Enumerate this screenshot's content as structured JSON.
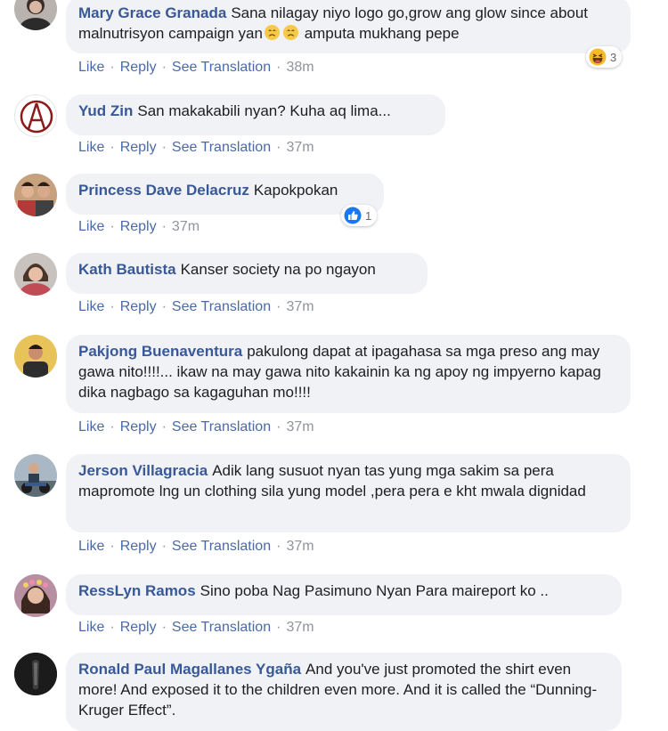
{
  "actions": {
    "like": "Like",
    "reply": "Reply",
    "see_translation": "See Translation"
  },
  "comments": [
    {
      "author": "Mary Grace Granada",
      "text": "Sana nilagay niyo logo go,grow ang glow since about malnutrisyon campaign yan",
      "text_tail": "amputa mukhang pepe",
      "time": "38m",
      "reaction": {
        "type": "haha-icon",
        "count": "3"
      },
      "show_translation": true
    },
    {
      "author": "Yud Zin",
      "text": "San makakabili nyan? Kuha aq lima...",
      "time": "37m",
      "show_translation": true
    },
    {
      "author": "Princess Dave Delacruz",
      "text": "Kapokpokan",
      "time": "37m",
      "reaction": {
        "type": "like-icon",
        "count": "1"
      },
      "show_translation": false
    },
    {
      "author": "Kath Bautista",
      "text": "Kanser society na po ngayon",
      "time": "37m",
      "show_translation": true
    },
    {
      "author": "Pakjong Buenaventura",
      "text": "pakulong dapat at ipagahasa sa mga preso ang may gawa nito!!!!... ikaw na may gawa nito kakainin ka ng apoy ng impyerno kapag dika nagbago sa kagaguhan mo!!!!",
      "time": "37m",
      "show_translation": true
    },
    {
      "author": "Jerson Villagracia",
      "text": "Adik lang susuot nyan tas yung mga sakim sa pera mapromote lng un clothing sila yung model ,pera pera e kht mwala dignidad",
      "time": "37m",
      "show_translation": true
    },
    {
      "author": "RessLyn Ramos",
      "text": "Sino poba Nag Pasimuno Nyan Para maireport ko ..",
      "time": "37m",
      "show_translation": true
    },
    {
      "author": "Ronald Paul Magallanes Ygaña",
      "text": "And you've just promoted the shirt even more! And exposed it to the children even more. And it is called the “Dunning-Kruger Effect”.",
      "show_translation": false
    }
  ],
  "colors": {
    "author": "#385898",
    "action_link": "#4b6aa6",
    "timestamp": "#90949c",
    "bubble": "#f0f2f5",
    "like_blue": "#1877f2"
  }
}
